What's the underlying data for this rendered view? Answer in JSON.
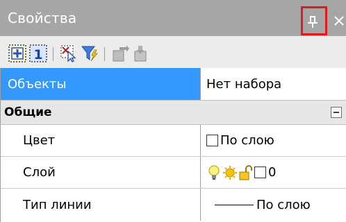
{
  "panel": {
    "title": "Свойства",
    "pin_label": "ⅱ",
    "close_label": "×"
  },
  "toolbar": {
    "buttons": [
      {
        "name": "toggle-pickadd-icon"
      },
      {
        "name": "pickadd-number-icon"
      },
      {
        "name": "select-objects-icon"
      },
      {
        "name": "quick-select-icon"
      },
      {
        "name": "match-properties-icon"
      },
      {
        "name": "copy-properties-icon"
      }
    ]
  },
  "selection": {
    "label": "Объекты",
    "value": "Нет набора"
  },
  "group": {
    "title": "Общие"
  },
  "properties": {
    "color": {
      "label": "Цвет",
      "value": "По слою"
    },
    "layer": {
      "label": "Слой",
      "value": "0"
    },
    "linetype": {
      "label": "Тип линии",
      "value": "По слою"
    }
  },
  "colors": {
    "titlebar": "#a6a6a6",
    "selection_highlight": "#3399ff",
    "pin_highlight": "#e01b1b"
  }
}
